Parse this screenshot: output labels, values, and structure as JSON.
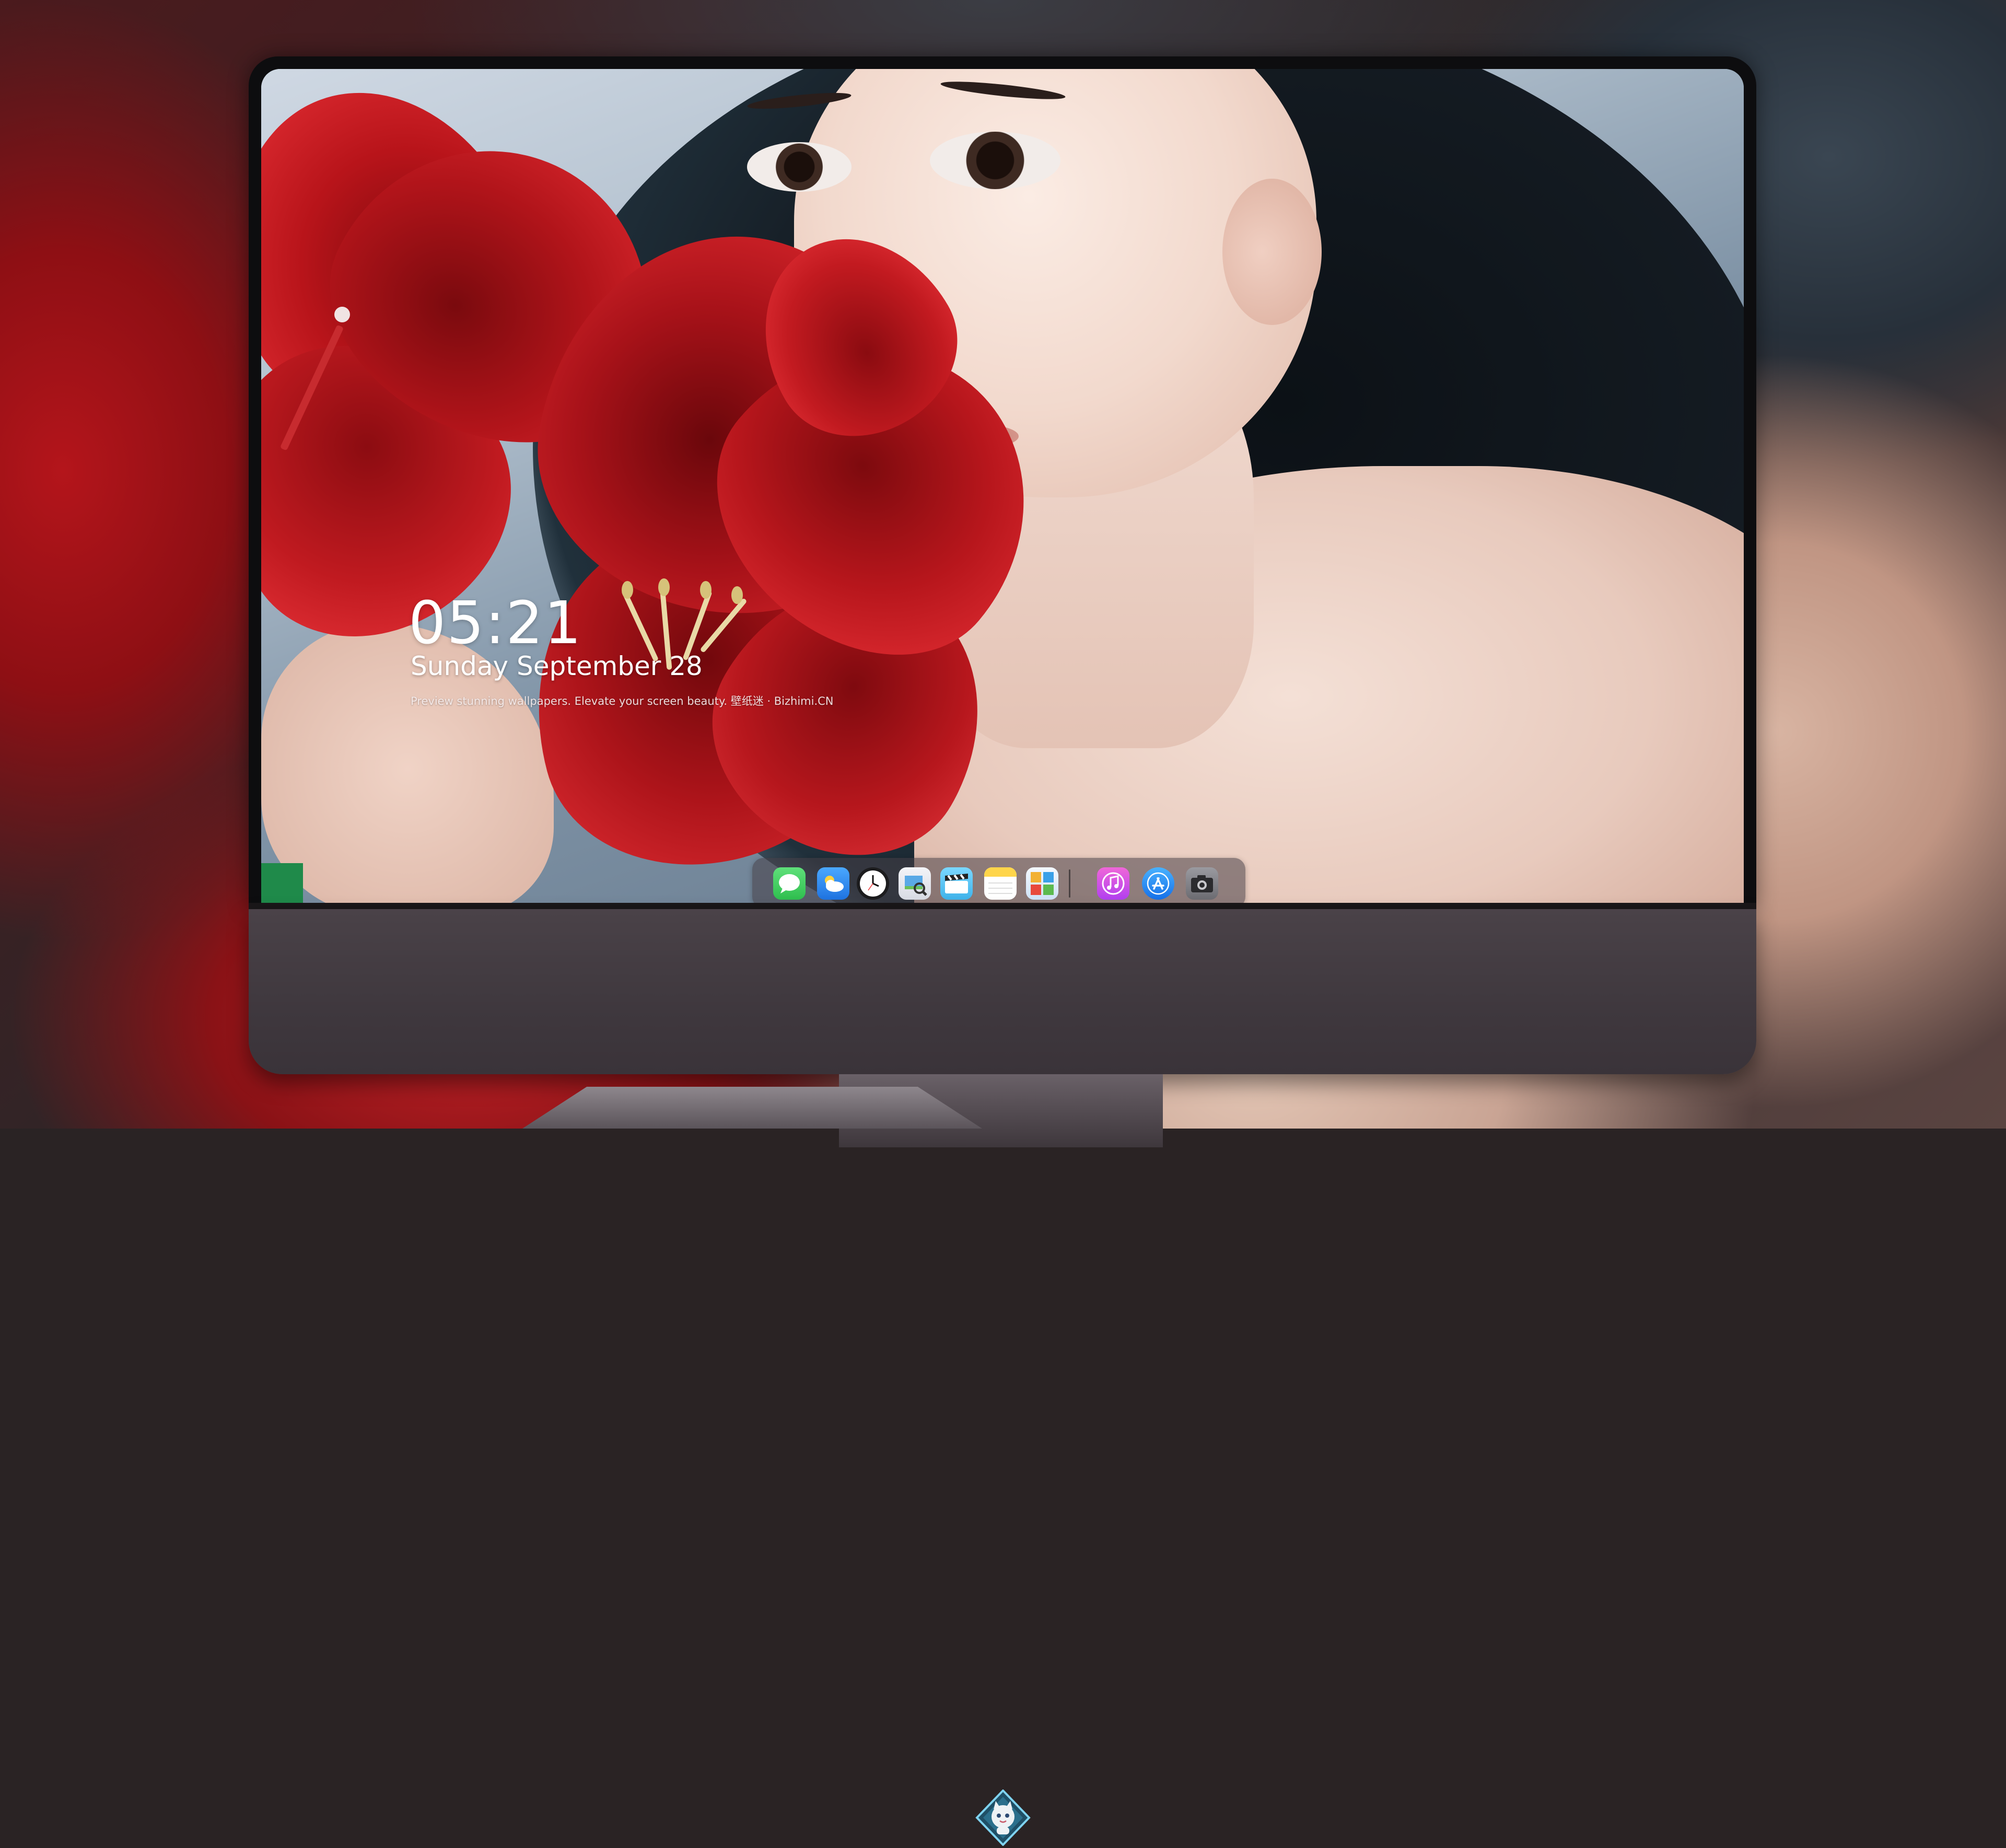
{
  "lockscreen": {
    "time": "05:21",
    "date": "Sunday September 28",
    "tagline": "Preview stunning wallpapers. Elevate your screen beauty. 壁纸迷 · Bizhimi.CN"
  },
  "dock": {
    "apps": [
      {
        "name": "messages-icon",
        "color": "#34c759"
      },
      {
        "name": "weather-icon",
        "color": "#2f8df5"
      },
      {
        "name": "clock-icon",
        "color": "#1c1c1e"
      },
      {
        "name": "preview-icon",
        "color": "#e9e9ee"
      },
      {
        "name": "clapper-icon",
        "color": "#5ac8fa"
      },
      {
        "name": "notes-icon",
        "color": "#ffd54a"
      },
      {
        "name": "photo-booth-icon",
        "color": "#e8f3ff"
      },
      {
        "name": "music-icon",
        "color": "#e84cc9"
      },
      {
        "name": "app-store-icon",
        "color": "#1e88f5"
      },
      {
        "name": "camera-icon",
        "color": "#8e8e93"
      }
    ]
  },
  "monitor": {
    "logo": "cat-mascot-icon"
  }
}
